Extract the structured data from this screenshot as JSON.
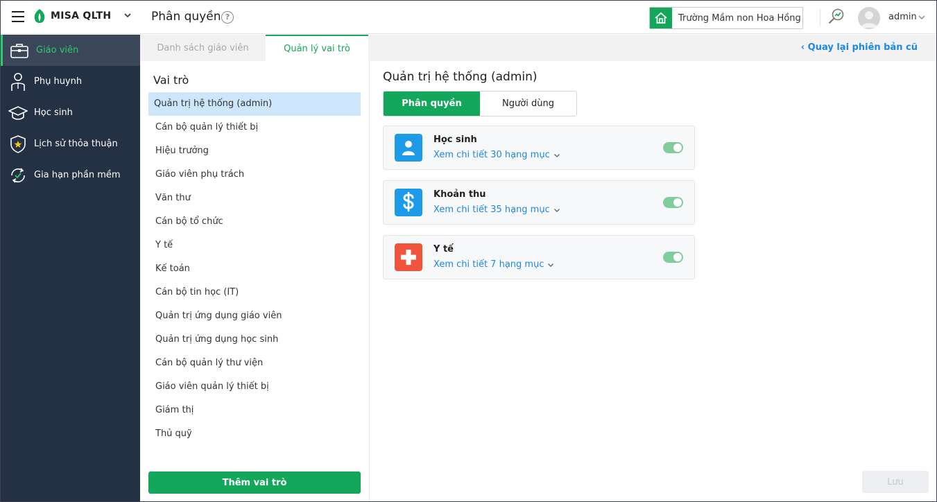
{
  "header": {
    "brand": "MISA QLTH",
    "page_title": "Phân quyền",
    "help_symbol": "?",
    "school_name": "Trường Mầm non Hoa Hồng",
    "user_name": "admin",
    "brand_color": "#12a75a"
  },
  "sidebar": {
    "items": [
      {
        "label": "Giáo viên",
        "icon": "briefcase-icon"
      },
      {
        "label": "Phụ huynh",
        "icon": "parent-icon"
      },
      {
        "label": "Học sinh",
        "icon": "graduation-cap-icon"
      },
      {
        "label": "Lịch sử thỏa thuận",
        "icon": "shield-star-icon"
      },
      {
        "label": "Gia hạn phần mềm",
        "icon": "renew-icon"
      }
    ],
    "active_index": 0,
    "bg_color": "#243043",
    "active_color": "#2ccb6f"
  },
  "tabs": [
    {
      "label": "Danh sách giáo viên"
    },
    {
      "label": "Quản lý vai trò"
    }
  ],
  "back_link": "Quay lại phiên bản cũ",
  "roles": {
    "heading": "Vai trò",
    "items": [
      "Quản trị hệ thống (admin)",
      "Cán bộ quản lý thiết bị",
      "Hiệu trưởng",
      "Giáo viên phụ trách",
      "Văn thư",
      "Cán bộ tổ chức",
      "Y tế",
      "Kế toán",
      "Cán bộ tin học (IT)",
      "Quản trị ứng dụng giáo viên",
      "Quản trị ứng dụng học sinh",
      "Cán bộ quản lý thư viện",
      "Giáo viên quản lý thiết bị",
      "Giám thị",
      "Thủ quỹ"
    ],
    "selected_index": 0,
    "add_button": "Thêm vai trò"
  },
  "main": {
    "title": "Quản trị hệ thống (admin)",
    "segments": [
      {
        "label": "Phân quyền"
      },
      {
        "label": "Người dùng"
      }
    ],
    "modules": [
      {
        "title": "Học sinh",
        "link": "Xem chi tiết 30 hạng mục",
        "icon": "student-icon",
        "color": "#1d9ae8",
        "enabled": true
      },
      {
        "title": "Khoản thu",
        "link": "Xem chi tiết 35 hạng mục",
        "icon": "dollar-icon",
        "color": "#1d9ae8",
        "enabled": true
      },
      {
        "title": "Y tế",
        "link": "Xem chi tiết 7 hạng mục",
        "icon": "medical-cross-icon",
        "color": "#f0543a",
        "enabled": true
      }
    ],
    "save_button": "Lưu"
  }
}
